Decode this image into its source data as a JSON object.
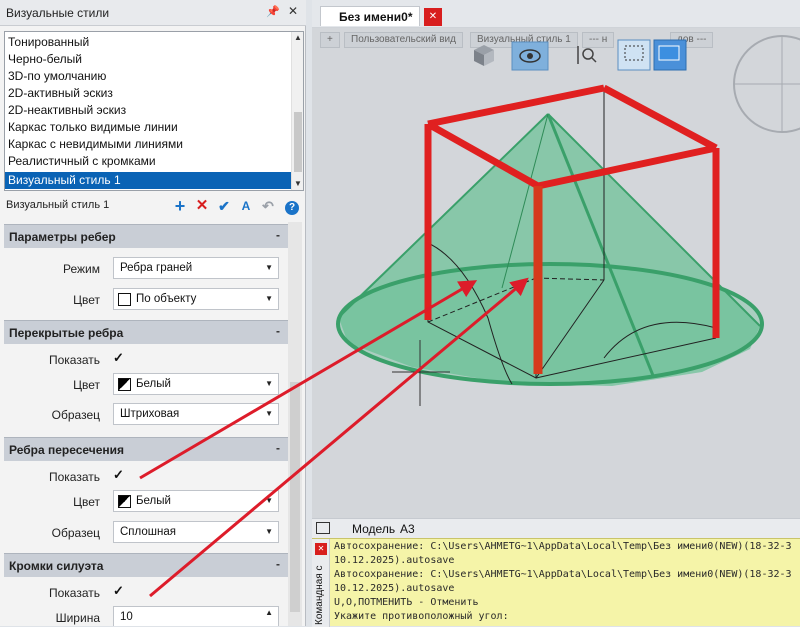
{
  "palette": {
    "title": "Визуальные стили",
    "styles": [
      "Тонированный",
      "Черно-белый",
      "3D-по умолчанию",
      "2D-активный эскиз",
      "2D-неактивный эскиз",
      "Каркас только видимые линии",
      "Каркас с невидимыми линиями",
      "Реалистичный с кромками",
      "Визуальный стиль 1"
    ],
    "selected_style": "Визуальный стиль 1",
    "current_name": "Визуальный стиль 1"
  },
  "props": {
    "edge_params": {
      "title": "Параметры ребер",
      "mode_label": "Режим",
      "mode_value": "Ребра граней",
      "color_label": "Цвет",
      "color_value": "По объекту"
    },
    "occluded_edges": {
      "title": "Перекрытые ребра",
      "show_label": "Показать",
      "color_label": "Цвет",
      "color_value": "Белый",
      "pattern_label": "Образец",
      "pattern_value": "Штриховая"
    },
    "intersection_edges": {
      "title": "Ребра пересечения",
      "show_label": "Показать",
      "color_label": "Цвет",
      "color_value": "Белый",
      "pattern_label": "Образец",
      "pattern_value": "Сплошная"
    },
    "silhouette_edges": {
      "title": "Кромки силуэта",
      "show_label": "Показать",
      "width_label": "Ширина",
      "width_value": "10"
    }
  },
  "document": {
    "tab_title": "Без имени0*"
  },
  "viewport": {
    "view_label": "Пользовательский вид",
    "style_label": "Визуальный стиль 1",
    "nav_placeholder": "--- н",
    "nav_suffix": "дов ---"
  },
  "bottom_tabs": {
    "model": "Модель",
    "a3": "А3"
  },
  "command": {
    "side_label": "Командная с",
    "lines": [
      "Автосохранение: C:\\Users\\AHMETG~1\\AppData\\Local\\Temp\\Без имени0(NEW)(18-32-3",
      "10.12.2025).autosave",
      "Автосохранение: C:\\Users\\AHMETG~1\\AppData\\Local\\Temp\\Без имени0(NEW)(18-32-3",
      "10.12.2025).autosave",
      "U,O,ПОТМЕНИТЬ - Отменить",
      "Укажите противоположный угол:"
    ]
  },
  "colors": {
    "selection": "#0a63b5",
    "cone_fill": "#5fbf8f",
    "frame": "#e02020",
    "arrow": "#dd1c2a",
    "command_bg": "#f5f4a8"
  }
}
